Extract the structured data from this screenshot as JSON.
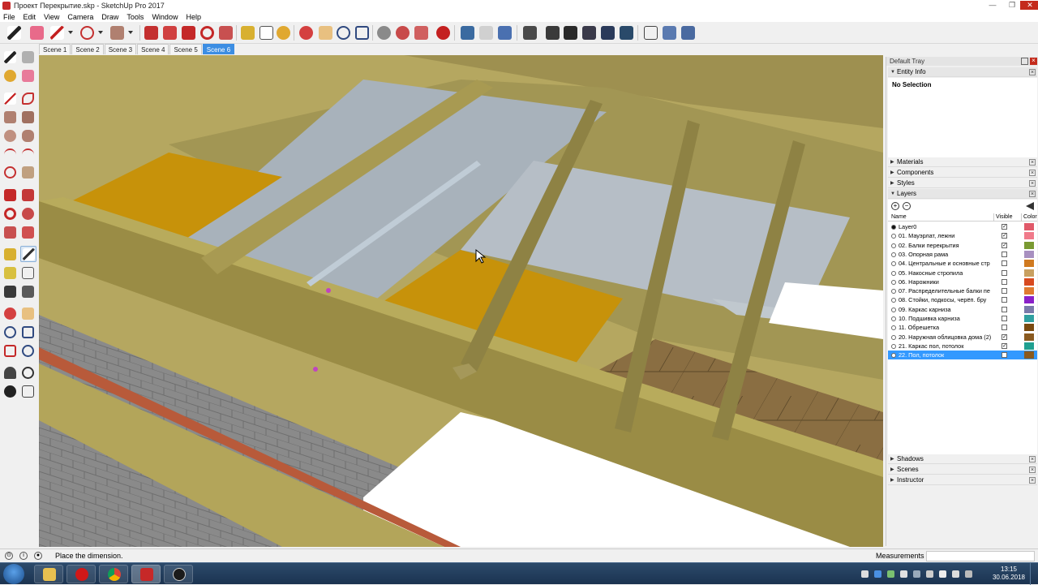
{
  "window": {
    "title": "Проект Перекрытие.skp - SketchUp Pro 2017",
    "controls": [
      "—",
      "❐",
      "✕"
    ]
  },
  "menu": [
    "File",
    "Edit",
    "View",
    "Camera",
    "Draw",
    "Tools",
    "Window",
    "Help"
  ],
  "scenes": {
    "tabs": [
      "Scene 1",
      "Scene 2",
      "Scene 3",
      "Scene 4",
      "Scene 5",
      "Scene 6"
    ],
    "active": "Scene 6"
  },
  "tray": {
    "title": "Default Tray",
    "entity_info": {
      "label": "Entity Info",
      "selection": "No Selection"
    },
    "collapsed_panels": [
      "Materials",
      "Components",
      "Styles"
    ],
    "layers": {
      "label": "Layers",
      "columns": {
        "name": "Name",
        "visible": "Visible",
        "color": "Color"
      },
      "rows": [
        {
          "name": "Layer0",
          "active": true,
          "visible": true,
          "color": "#e05a6a"
        },
        {
          "name": "01. Мауэрлат, лежни",
          "active": false,
          "visible": true,
          "color": "#f07a8a"
        },
        {
          "name": "02. Балки перекрытия",
          "active": false,
          "visible": true,
          "color": "#7a9a32"
        },
        {
          "name": "03. Опорная рама",
          "active": false,
          "visible": false,
          "color": "#a890c0"
        },
        {
          "name": "04. Центральные и основные стр",
          "active": false,
          "visible": false,
          "color": "#d07a20"
        },
        {
          "name": "05. Накосные стропила",
          "active": false,
          "visible": false,
          "color": "#c8a060"
        },
        {
          "name": "06. Нарожники",
          "active": false,
          "visible": false,
          "color": "#d84a20"
        },
        {
          "name": "07. Распределительные балки пе",
          "active": false,
          "visible": false,
          "color": "#e07a30"
        },
        {
          "name": "08. Стойки, подкосы, черёп. бру",
          "active": false,
          "visible": false,
          "color": "#8a20c8"
        },
        {
          "name": "09. Каркас карниза",
          "active": false,
          "visible": false,
          "color": "#7a7aaa"
        },
        {
          "name": "10. Подшивка карниза",
          "active": false,
          "visible": false,
          "color": "#30a0a0"
        },
        {
          "name": "11. Обрешетка",
          "active": false,
          "visible": false,
          "color": "#7a4a10"
        },
        {
          "name": "20. Наружная облицовка дома (2)",
          "active": false,
          "visible": true,
          "color": "#8a5a20"
        },
        {
          "name": "21. Каркас пол, потолок",
          "active": false,
          "visible": true,
          "color": "#20a090"
        },
        {
          "name": "22. Пол, потолок",
          "active": false,
          "visible": false,
          "color": "#8a5a20",
          "selected": true
        }
      ]
    },
    "bottom_panels": [
      "Shadows",
      "Scenes",
      "Instructor"
    ]
  },
  "status": {
    "text": "Place the dimension.",
    "measurements_label": "Measurements",
    "measurements_value": ""
  },
  "taskbar": {
    "apps": [
      "explorer-icon",
      "opera-icon",
      "chrome-icon",
      "sketchup-icon",
      "steam-icon"
    ],
    "time": "13:15",
    "date": "30.06.2018"
  }
}
